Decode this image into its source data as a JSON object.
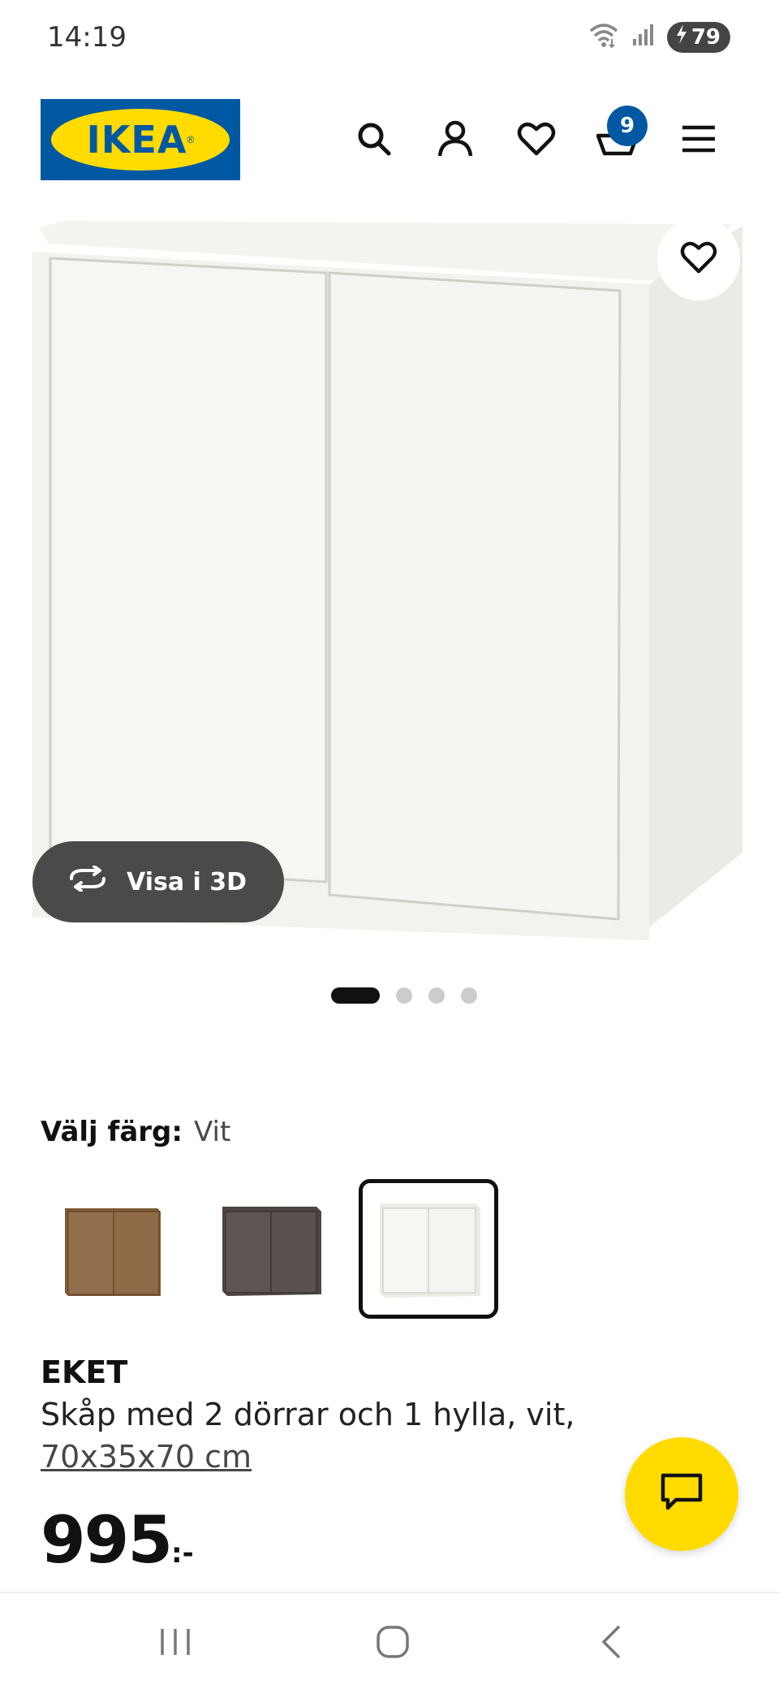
{
  "status_bar": {
    "time": "14:19",
    "battery": "79"
  },
  "header": {
    "logo_text": "IKEA",
    "cart_count": "9",
    "icons": [
      "search-icon",
      "account-icon",
      "heart-icon",
      "cart-icon",
      "menu-icon"
    ]
  },
  "product_image": {
    "view_3d_label": "Visa i 3D",
    "carousel_total": 4,
    "carousel_active": 1
  },
  "color_selector": {
    "label": "Välj färg:",
    "selected_value": "Vit",
    "options": [
      {
        "name": "walnut",
        "color": "#8a6440"
      },
      {
        "name": "dark-grey",
        "color": "#5e5552"
      },
      {
        "name": "white",
        "color": "#f6f6f2"
      }
    ]
  },
  "product": {
    "name": "EKET",
    "description": "Skåp med 2 dörrar och 1 hylla, vit,",
    "size": "70x35x70 cm",
    "price": "995",
    "price_suffix": ":-"
  },
  "colors": {
    "ikea_blue": "#0058a3",
    "ikea_yellow": "#ffdb00"
  }
}
